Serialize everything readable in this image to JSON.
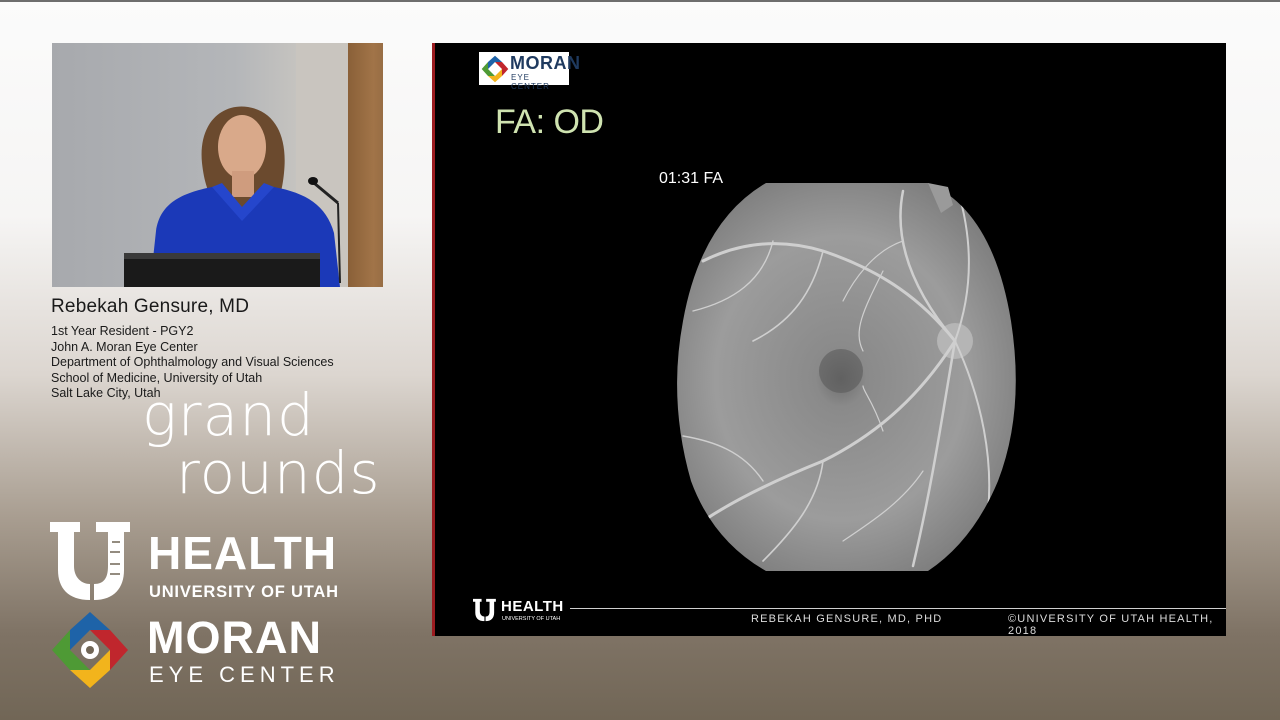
{
  "speaker": {
    "name": "Rebekah Gensure, MD",
    "details": [
      "1st Year Resident - PGY2",
      "John A. Moran Eye Center",
      "Department of Ophthalmology and Visual Sciences",
      "School of Medicine, University of Utah",
      "Salt Lake City, Utah"
    ]
  },
  "branding": {
    "grand": "grand",
    "rounds": "rounds",
    "health_word": "HEALTH",
    "health_sub": "UNIVERSITY OF UTAH",
    "moran_word": "MORAN",
    "moran_sub": "EYE CENTER"
  },
  "slide": {
    "logo_word": "MORAN",
    "logo_sub": "EYE CENTER",
    "title": "FA: OD",
    "image_label": "01:31 FA",
    "footer_health": "HEALTH",
    "footer_health_sub": "UNIVERSITY OF UTAH",
    "footer_author": "REBEKAH GENSURE, MD, PHD",
    "footer_copyright": "©UNIVERSITY OF UTAH HEALTH, 2018"
  },
  "colors": {
    "slide_title": "#cfe3b0",
    "slide_border": "#9b1c20",
    "moran_navy": "#1f3a5f",
    "logo_blue": "#1e63a8",
    "logo_red": "#c0262d",
    "logo_yellow": "#f2b41c",
    "logo_green": "#4e9a35"
  }
}
